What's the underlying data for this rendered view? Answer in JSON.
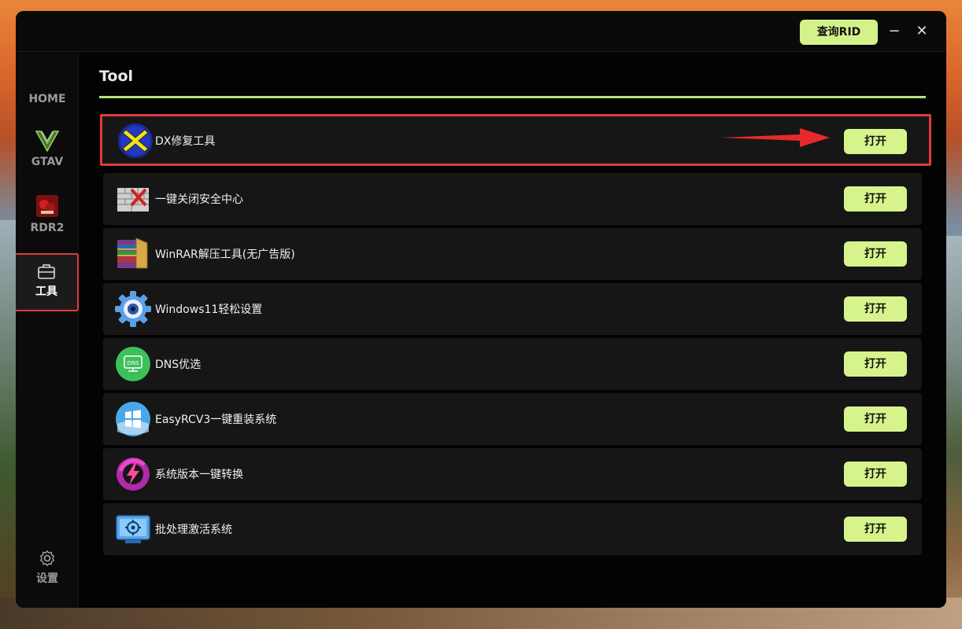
{
  "window": {
    "rid_button": "查询RID",
    "minimize": "−",
    "close": "✕"
  },
  "sidebar": {
    "items": [
      {
        "label": "HOME"
      },
      {
        "label": "GTAV"
      },
      {
        "label": "RDR2"
      },
      {
        "label": "工具"
      },
      {
        "label": "设置"
      }
    ]
  },
  "main": {
    "title": "Tool",
    "tools": [
      {
        "name": "DX修复工具",
        "button": "打开"
      },
      {
        "name": "一键关闭安全中心",
        "button": "打开"
      },
      {
        "name": "WinRAR解压工具(无广告版)",
        "button": "打开"
      },
      {
        "name": "Windows11轻松设置",
        "button": "打开"
      },
      {
        "name": "DNS优选",
        "button": "打开"
      },
      {
        "name": "EasyRCV3一键重装系统",
        "button": "打开"
      },
      {
        "name": "系统版本一键转换",
        "button": "打开"
      },
      {
        "name": "批处理激活系统",
        "button": "打开"
      }
    ],
    "dns_icon_text": "DNS"
  },
  "colors": {
    "accent": "#d7f48c",
    "highlight_border": "#e23b3b",
    "title_underline": "#b8e07a"
  }
}
